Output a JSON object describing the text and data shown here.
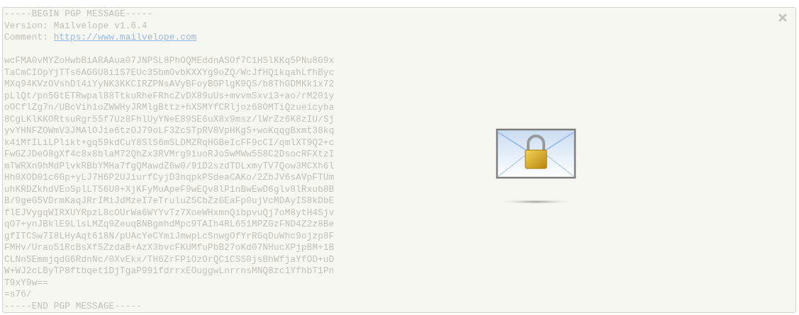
{
  "message": {
    "lines": [
      {
        "kind": "text",
        "text": "-----BEGIN PGP MESSAGE-----"
      },
      {
        "kind": "text",
        "text": "Version: Mailvelope v1.6.4"
      },
      {
        "kind": "link",
        "label": "Comment:",
        "url": "https://www.mailvelope.com"
      },
      {
        "kind": "blank"
      },
      {
        "kind": "text",
        "text": "wcFMA0vMYZoHwbBiARAAua07JNPSL8PhOQMEddnASOf7C1HSlKKq5PNu8G9x"
      },
      {
        "kind": "text",
        "text": "TaCmCIOpYjTTs6AGGU8i1S7EUc35bmOvbKXXYg9oZQ/WcJfHQikqahLfhByc"
      },
      {
        "kind": "text",
        "text": "MXq94KVzOVshDl4iYyNK3KKCIRZPNsAVyBFoyBGPlgK9QS/b8ThGDMKk1x72"
      },
      {
        "kind": "text",
        "text": "pLlQt/pn5GtETRwpal88TtkuRheFRhcZvDX89uUs+mvvmSxvi3+ao/rM201y"
      },
      {
        "kind": "text",
        "text": "oOCflZg7n/UBcVih1oZWWHyJRMlgBttz+hXSMYfCRljoz68OMTiQzueicyba"
      },
      {
        "kind": "text",
        "text": "8CgLKlKKORtsuRgr55f7Uz8FhlUyYNeE89SE6uX8x9msz/lWrZz6K8zIU/Sj"
      },
      {
        "kind": "text",
        "text": "yvYHNFZOWmV3JMAlOJie6tzOJ79oLF3ZcSTpRV8VpHKgS+woKqqgBxmt38kq"
      },
      {
        "kind": "text",
        "text": "k4iMfILiLPlikt+gq59kdCuY8SlS6mSLDMZRqHGBeIcFF9cCI/qmlXT9Q2+c"
      },
      {
        "kind": "text",
        "text": "FwGZJDeO8gXf4c8x8blaM72QhZx3RVMrg9iuoRJo5wMWw558C2DsocRFXtzI"
      },
      {
        "kind": "text",
        "text": "mTWRXn9hMdPlvkRBbYMHa7fgQMawdZ6w0/91D2szdTDLxmyTV7Qow3MCXh6l"
      },
      {
        "kind": "text",
        "text": "Hh0XOD01c6Gp+yLJ7H6P2UJiurfCyjD3nqpkPSdeaCAKo/2ZbJV6sAVpFTUm"
      },
      {
        "kind": "text",
        "text": "uhKRDZkhdVEoSplLT56U0+XjKFyMuApeF9wEQv8lP1nBwEwD6glv8lRxub8B"
      },
      {
        "kind": "text",
        "text": "B/9geG5VDrmKaqJRrIMiJdMzeI7eTruluZSCbZzGEaFp0ujVcMDAyIS8kDbE"
      },
      {
        "kind": "text",
        "text": "flEJVygqWIRXUYRpzL8cOUrWa6WYYvTz7XoeWHxmnQibpvuQj7oM8ytH4Sjv"
      },
      {
        "kind": "text",
        "text": "qO7+ynJBklE9LlsLMZq9ZeuqBNBgmhdMpc9TAIh4RL651MPZGzFND4Z2z8Be"
      },
      {
        "kind": "text",
        "text": "gfITCSw7I8LHyAqt618N/pUAcYeCYmiJmwpLcSnwgOfYrRGqDuWhc9ojzp8F"
      },
      {
        "kind": "text",
        "text": "FMHv/Urao51RcBsXf5ZzdaB+AzX3bvcFKUMfuPbB27oKd07NHucXPjpBM+1B"
      },
      {
        "kind": "text",
        "text": "CLNnSEmmjqdG6RdnNc/0XvEkx/TH6ZrFP1OzOrQC1CSS0jsBhWfjaYfOD+uD"
      },
      {
        "kind": "text",
        "text": "W+WJ2cLByTP8ftbqet1DjTgaP991fdrrxEOuggwLnrrnsMNQ8zc1YfhbT1Pn"
      },
      {
        "kind": "text",
        "text": "T9xY9w=="
      },
      {
        "kind": "text",
        "text": "=s76/"
      },
      {
        "kind": "text",
        "text": "-----END PGP MESSAGE-----"
      }
    ]
  }
}
